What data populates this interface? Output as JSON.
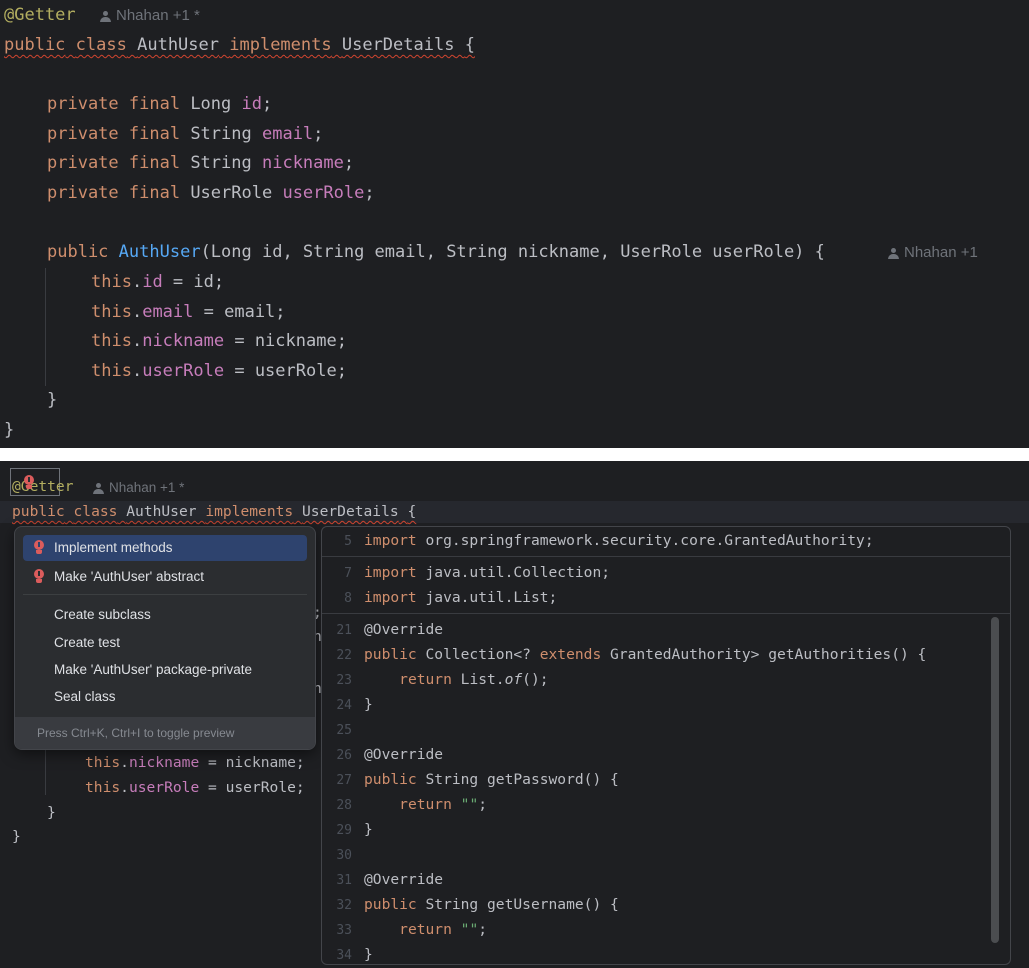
{
  "top_editor": {
    "annotation": "@Getter",
    "author_hint": "Nhahan +1 *",
    "class_decl": {
      "kw_public": "public",
      "kw_class": "class",
      "name": "AuthUser",
      "kw_implements": "implements",
      "iface": "UserDetails",
      "brace": "{"
    },
    "fields": [
      {
        "mods": "private final",
        "type": "Long",
        "name": "id"
      },
      {
        "mods": "private final",
        "type": "String",
        "name": "email"
      },
      {
        "mods": "private final",
        "type": "String",
        "name": "nickname"
      },
      {
        "mods": "private final",
        "type": "UserRole",
        "name": "userRole"
      }
    ],
    "ctor": {
      "kw_public": "public",
      "name": "AuthUser",
      "params": "(Long id, String email, String nickname, UserRole userRole) {",
      "author_hint": "Nhahan +1"
    },
    "assignments": [
      {
        "this": "this",
        "field": "id",
        "rhs": "id"
      },
      {
        "this": "this",
        "field": "email",
        "rhs": "email"
      },
      {
        "this": "this",
        "field": "nickname",
        "rhs": "nickname"
      },
      {
        "this": "this",
        "field": "userRole",
        "rhs": "userRole"
      }
    ],
    "close_inner": "}",
    "close_outer": "}"
  },
  "bottom_editor": {
    "annotation": "@Getter",
    "author_hint": "Nhahan +1 *",
    "class_decl": {
      "kw_public": "public",
      "kw_class": "class",
      "name": "AuthUser",
      "kw_implements": "implements",
      "iface": "UserDetails",
      "brace": "{"
    },
    "visible_lines": [
      {
        "this": "this",
        "field": "nickname",
        "rhs": "nickname;"
      },
      {
        "this": "this",
        "field": "userRole",
        "rhs": "userRole;"
      }
    ],
    "close_inner": "}",
    "close_outer": "}",
    "peek_chars": [
      ";",
      "n",
      "n"
    ]
  },
  "intention_popup": {
    "items": [
      {
        "label": "Implement methods",
        "icon": "red-bulb-icon",
        "selected": true
      },
      {
        "label": "Make 'AuthUser' abstract",
        "icon": "red-bulb-icon",
        "selected": false
      },
      {
        "label": "Create subclass"
      },
      {
        "label": "Create test"
      },
      {
        "label": "Make 'AuthUser' package-private"
      },
      {
        "label": "Seal class"
      }
    ],
    "footer": "Press Ctrl+K, Ctrl+I to toggle preview"
  },
  "preview": {
    "lines": [
      {
        "num": "5",
        "code": "import org.springframework.security.core.GrantedAuthority;"
      },
      {
        "num": "7",
        "code": "import java.util.Collection;"
      },
      {
        "num": "8",
        "code": "import java.util.List;"
      },
      {
        "num": "21",
        "code": "@Override"
      },
      {
        "num": "22",
        "code": "public Collection<? extends GrantedAuthority> getAuthorities() {"
      },
      {
        "num": "23",
        "code": "    return List.of();"
      },
      {
        "num": "24",
        "code": "}"
      },
      {
        "num": "25",
        "code": ""
      },
      {
        "num": "26",
        "code": "@Override"
      },
      {
        "num": "27",
        "code": "public String getPassword() {"
      },
      {
        "num": "28",
        "code": "    return \"\";"
      },
      {
        "num": "29",
        "code": "}"
      },
      {
        "num": "30",
        "code": ""
      },
      {
        "num": "31",
        "code": "@Override"
      },
      {
        "num": "32",
        "code": "public String getUsername() {"
      },
      {
        "num": "33",
        "code": "    return \"\";"
      },
      {
        "num": "34",
        "code": "}"
      }
    ]
  },
  "colors": {
    "background": "#1e1f22",
    "keyword": "#cf8e6d",
    "field": "#c77dbb",
    "annotation": "#b3ae60",
    "method": "#56a8f5",
    "selection": "#2e436e",
    "error": "#db5c5c"
  }
}
